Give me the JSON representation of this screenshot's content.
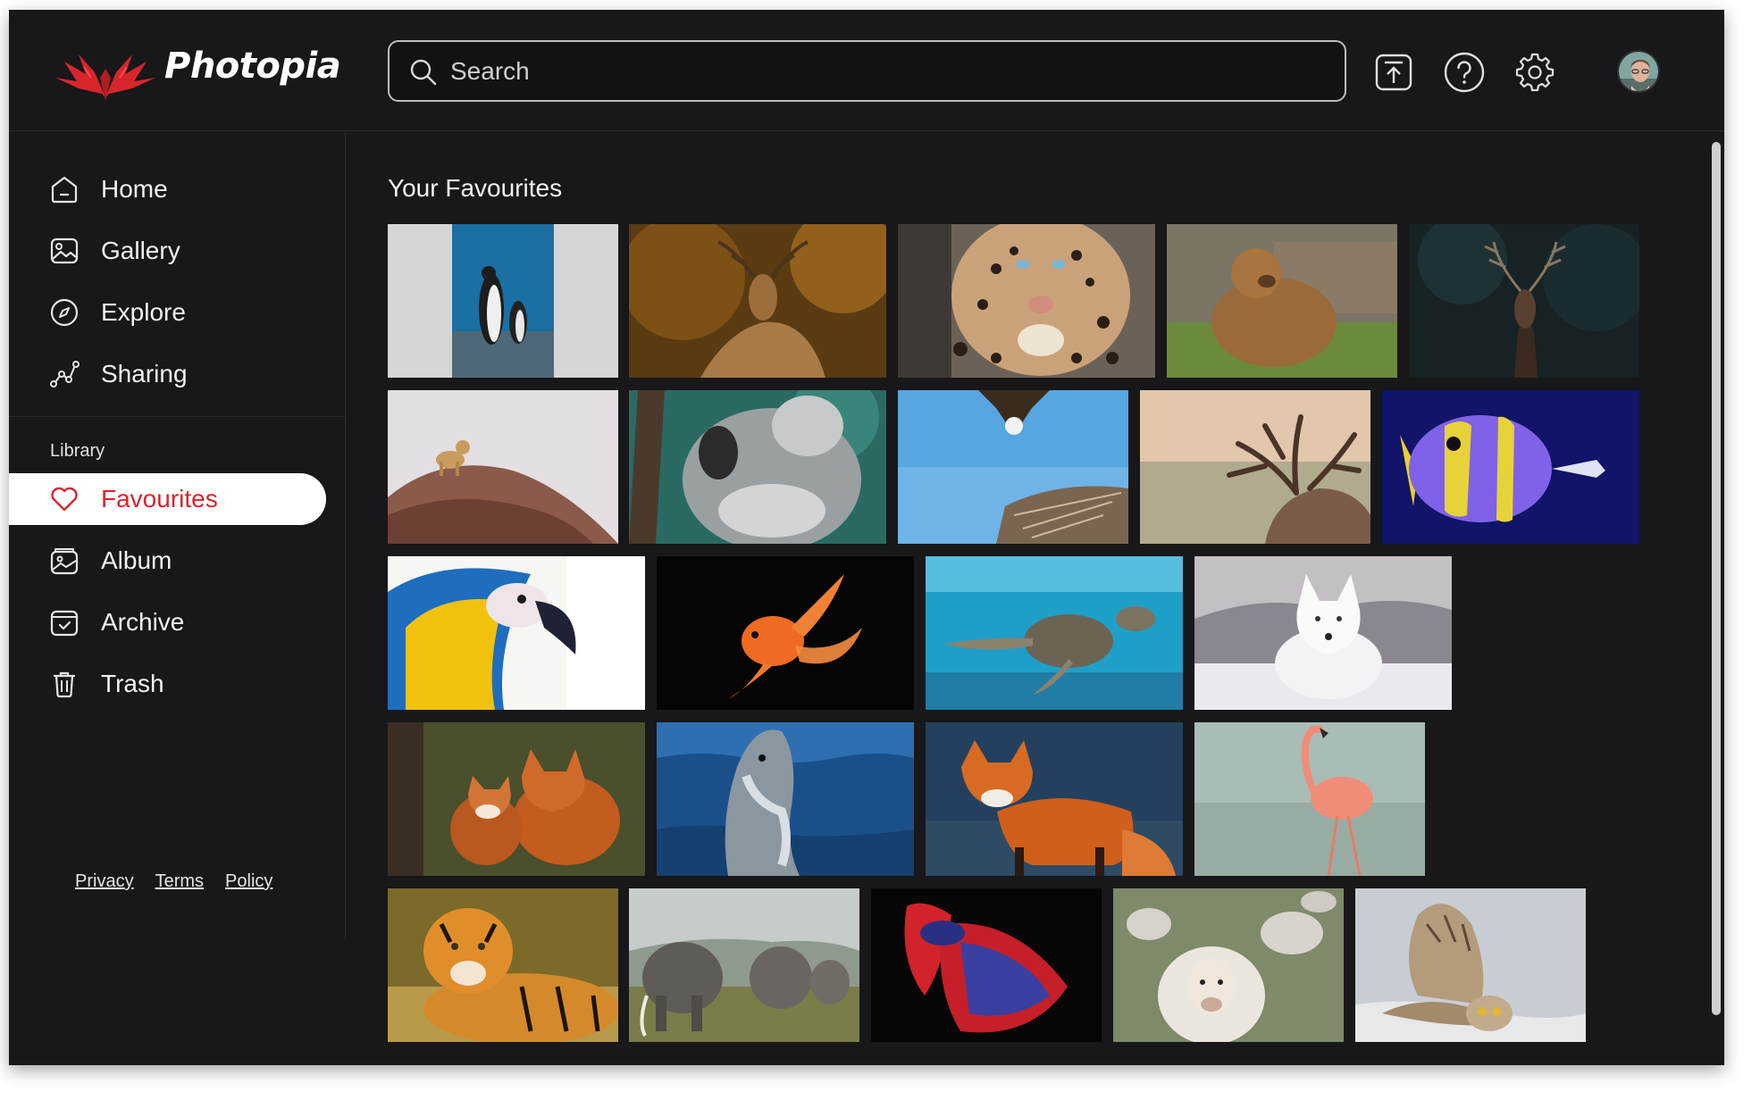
{
  "app": {
    "name": "Photopia",
    "brand_color": "#d9262c"
  },
  "search": {
    "placeholder": "Search",
    "value": ""
  },
  "header_actions": [
    {
      "name": "upload-icon"
    },
    {
      "name": "help-icon"
    },
    {
      "name": "gear-icon"
    },
    {
      "name": "avatar"
    }
  ],
  "sidebar": {
    "items": [
      {
        "label": "Home",
        "icon": "home-icon"
      },
      {
        "label": "Gallery",
        "icon": "image-icon"
      },
      {
        "label": "Explore",
        "icon": "compass-icon"
      },
      {
        "label": "Sharing",
        "icon": "share-graph-icon"
      }
    ],
    "library_label": "Library",
    "library_items": [
      {
        "label": "Favourites",
        "icon": "heart-icon",
        "active": true
      },
      {
        "label": "Album",
        "icon": "album-icon"
      },
      {
        "label": "Archive",
        "icon": "archive-icon"
      },
      {
        "label": "Trash",
        "icon": "trash-icon"
      }
    ],
    "footer_links": [
      "Privacy",
      "Terms",
      "Policy"
    ]
  },
  "main": {
    "title": "Your Favourites",
    "photos": [
      "penguin",
      "deer",
      "leopard",
      "bear",
      "stag",
      "cheetah-cub",
      "koala",
      "eagle",
      "elk",
      "butterflyfish",
      "macaw",
      "goldfish",
      "sea-turtle",
      "white-wolf",
      "foxes",
      "dolphin",
      "red-fox",
      "flamingo",
      "tiger",
      "elephants",
      "betta-fish",
      "sheep",
      "owl"
    ]
  }
}
